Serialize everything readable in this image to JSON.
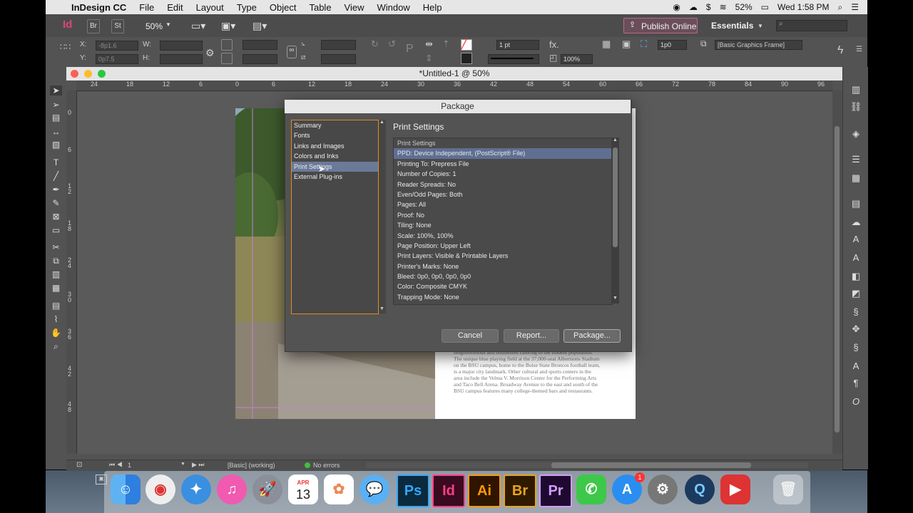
{
  "menubar": {
    "app_name": "InDesign CC",
    "items": [
      "File",
      "Edit",
      "Layout",
      "Type",
      "Object",
      "Table",
      "View",
      "Window",
      "Help"
    ],
    "battery": "52%",
    "clock": "Wed 1:58 PM"
  },
  "appbar": {
    "app_badge": "Id",
    "br": "Br",
    "st": "St",
    "zoom": "50%",
    "publish_label": "Publish Online",
    "workspace": "Essentials"
  },
  "control": {
    "x_label": "X:",
    "x_value": "-8p1.6",
    "y_label": "Y:",
    "y_value": "0p7.5",
    "w_label": "W:",
    "h_label": "H:",
    "stroke_weight": "1 pt",
    "opacity": "100%",
    "gap_value": "1p0",
    "object_style": "[Basic Graphics Frame]"
  },
  "document": {
    "title": "*Untitled-1 @ 50%"
  },
  "rulers": {
    "h_ticks": [
      "24",
      "18",
      "12",
      "6",
      "0",
      "6",
      "12",
      "18",
      "24",
      "30",
      "36",
      "42",
      "48",
      "54",
      "60",
      "66",
      "72",
      "78",
      "84",
      "90",
      "96"
    ],
    "v_ticks": [
      "0",
      "6",
      "1 2",
      "1 8",
      "2 4",
      "3 0",
      "3 6",
      "4 2",
      "4 8"
    ]
  },
  "page_text": "neighborhoods and businesses catering to the student population. The unique blue playing field at the 37,000-seat Albertsons Stadium on the BSU campus, home to the Boise State Broncos football team, is a major city landmark. Other cultural and sports centers in the area include the Velma V. Morrison Center for the Performing Arts and Taco Bell Arena. Broadway Avenue to the east and south of the BSU campus features many college-themed bars and restaurants.",
  "dialog": {
    "title": "Package",
    "nav": [
      {
        "label": "Summary",
        "selected": false
      },
      {
        "label": "Fonts",
        "selected": false
      },
      {
        "label": "Links and Images",
        "selected": false
      },
      {
        "label": "Colors and Inks",
        "selected": false
      },
      {
        "label": "Print Settings",
        "selected": true
      },
      {
        "label": "External Plug-ins",
        "selected": false
      }
    ],
    "section_title": "Print Settings",
    "settings_header": "Print Settings",
    "settings": [
      {
        "text": "PPD: Device Independent, (PostScript® File)",
        "selected": true
      },
      {
        "text": "Printing To: Prepress File",
        "selected": false
      },
      {
        "text": "Number of Copies: 1",
        "selected": false
      },
      {
        "text": "Reader Spreads: No",
        "selected": false
      },
      {
        "text": "Even/Odd Pages: Both",
        "selected": false
      },
      {
        "text": "Pages: All",
        "selected": false
      },
      {
        "text": "Proof: No",
        "selected": false
      },
      {
        "text": "Tiling: None",
        "selected": false
      },
      {
        "text": "Scale: 100%, 100%",
        "selected": false
      },
      {
        "text": "Page Position: Upper Left",
        "selected": false
      },
      {
        "text": "Print Layers: Visible & Printable Layers",
        "selected": false
      },
      {
        "text": "Printer's Marks: None",
        "selected": false
      },
      {
        "text": "Bleed: 0p0, 0p0, 0p0, 0p0",
        "selected": false
      },
      {
        "text": "Color: Composite CMYK",
        "selected": false
      },
      {
        "text": "Trapping Mode: None",
        "selected": false
      }
    ],
    "cancel": "Cancel",
    "report": "Report...",
    "package": "Package..."
  },
  "statusbar": {
    "page": "1",
    "profile": "[Basic] (working)",
    "errors": "No errors"
  },
  "dock": {
    "calendar_month": "APR",
    "calendar_day": "13",
    "ps": "Ps",
    "id": "Id",
    "ai": "Ai",
    "br": "Br",
    "pr": "Pr",
    "appstore_badge": "1"
  },
  "colors": {
    "accent_orange": "#e58a1f",
    "selection_blue": "#5e6f92",
    "ui_gray": "#535353"
  }
}
